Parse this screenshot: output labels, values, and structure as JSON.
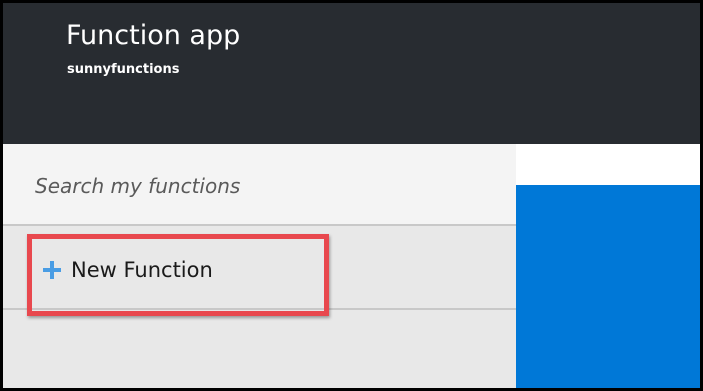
{
  "header": {
    "title": "Function app",
    "subtitle": "sunnyfunctions"
  },
  "sidebar": {
    "search": {
      "placeholder": "Search my functions",
      "value": ""
    },
    "new_function": {
      "label": "New Function",
      "icon": "plus-icon"
    }
  },
  "annotation": {
    "highlight_color": "#e8484e"
  },
  "colors": {
    "header_bg": "#282c31",
    "sidebar_bg": "#e8e8e8",
    "search_bg": "#f4f4f4",
    "accent_blue": "#0078d7",
    "plus_icon": "#4a9de4"
  }
}
